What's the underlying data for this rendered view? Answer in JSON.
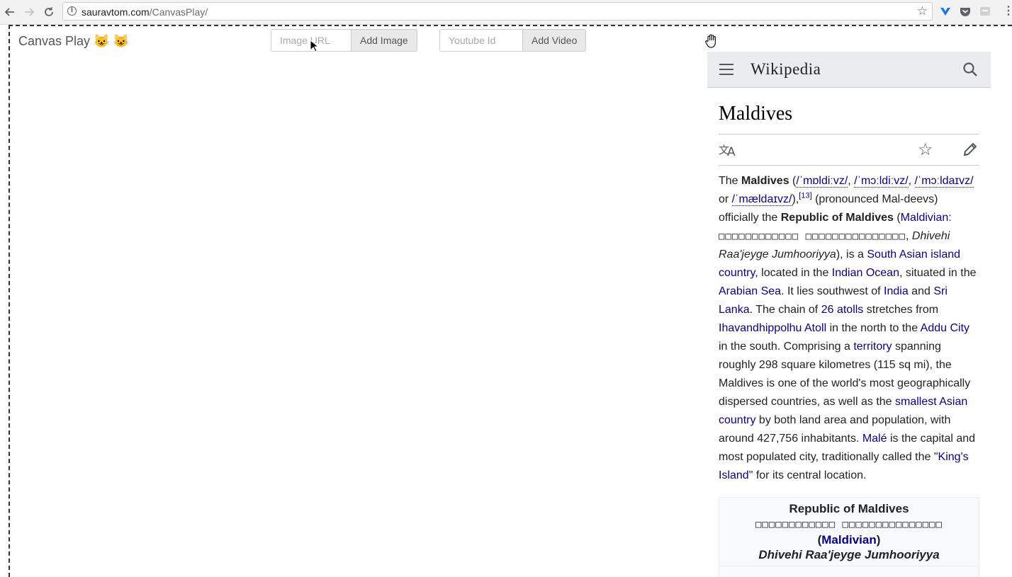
{
  "browser": {
    "url_host": "sauravtom.com",
    "url_path": "/CanvasPlay/",
    "back_icon": "arrow-left-icon",
    "forward_icon": "arrow-right-icon",
    "reload_icon": "reload-icon"
  },
  "app": {
    "title": "Canvas Play",
    "title_emoji": "😺 😺",
    "image_input_placeholder": "Image URL",
    "add_image_label": "Add Image",
    "video_input_placeholder": "Youtube Id",
    "add_video_label": "Add Video"
  },
  "wiki": {
    "logo": "Wikipedia",
    "heading": "Maldives",
    "lead": {
      "t1": "The ",
      "b1": "Maldives",
      "t2": " (",
      "ipa1": "/ˈmɒldiːvz/",
      "t3": ", ",
      "ipa2": "/ˈmɔːldiːvz/",
      "t4": ", ",
      "ipa3": "/ˈmɔːldaɪvz/",
      "t5": " or ",
      "ipa4": "/ˈmældaɪvz/",
      "t6": "),",
      "ref": "[13]",
      "t7": " (pronounced Mal-deevs) officially the ",
      "b2": "Republic of Maldives",
      "t8": " (",
      "l_maldivian": "Maldivian",
      "t9": ": ",
      "boxes": "□□□□□□□□□□□□ □□□□□□□□□□□□□□□",
      "t10": ", ",
      "i1": "Dhivehi Raa'jeyge Jumhooriyya",
      "t11": "), is a ",
      "l_sai": "South Asian island country",
      "t12": ", located in the ",
      "l_io": "Indian Ocean",
      "t13": ", situated in the ",
      "l_as": "Arabian Sea",
      "t14": ". It lies southwest of ",
      "l_india": "India",
      "t15": " and ",
      "l_sl": "Sri Lanka",
      "t16": ". The chain of ",
      "l_atolls": "26 atolls",
      "t17": " stretches from ",
      "l_iha": "Ihavandhippolhu Atoll",
      "t18": " in the north to the ",
      "l_addu": "Addu City",
      "t19": " in the south. Comprising a ",
      "l_terr": "territory",
      "t20": " spanning roughly 298 square kilometres (115 sq mi), the Maldives is one of the world's most geographically dispersed countries, as well as the ",
      "l_sac": "smallest Asian country",
      "t21": " by both land area and population, with around 427,756 inhabitants. ",
      "l_male": "Malé",
      "t22": " is the capital and most populated city, traditionally called the \"",
      "l_king": "King's Island",
      "t23": "\" for its central location."
    },
    "infobox": {
      "title": "Republic of Maldives",
      "native": "□□□□□□□□□□□□ □□□□□□□□□□□□□□□",
      "lang_open": "(",
      "lang_link": "Maldivian",
      "lang_close": ")",
      "roman": "Dhivehi Raa'jeyge Jumhooriyya"
    }
  }
}
